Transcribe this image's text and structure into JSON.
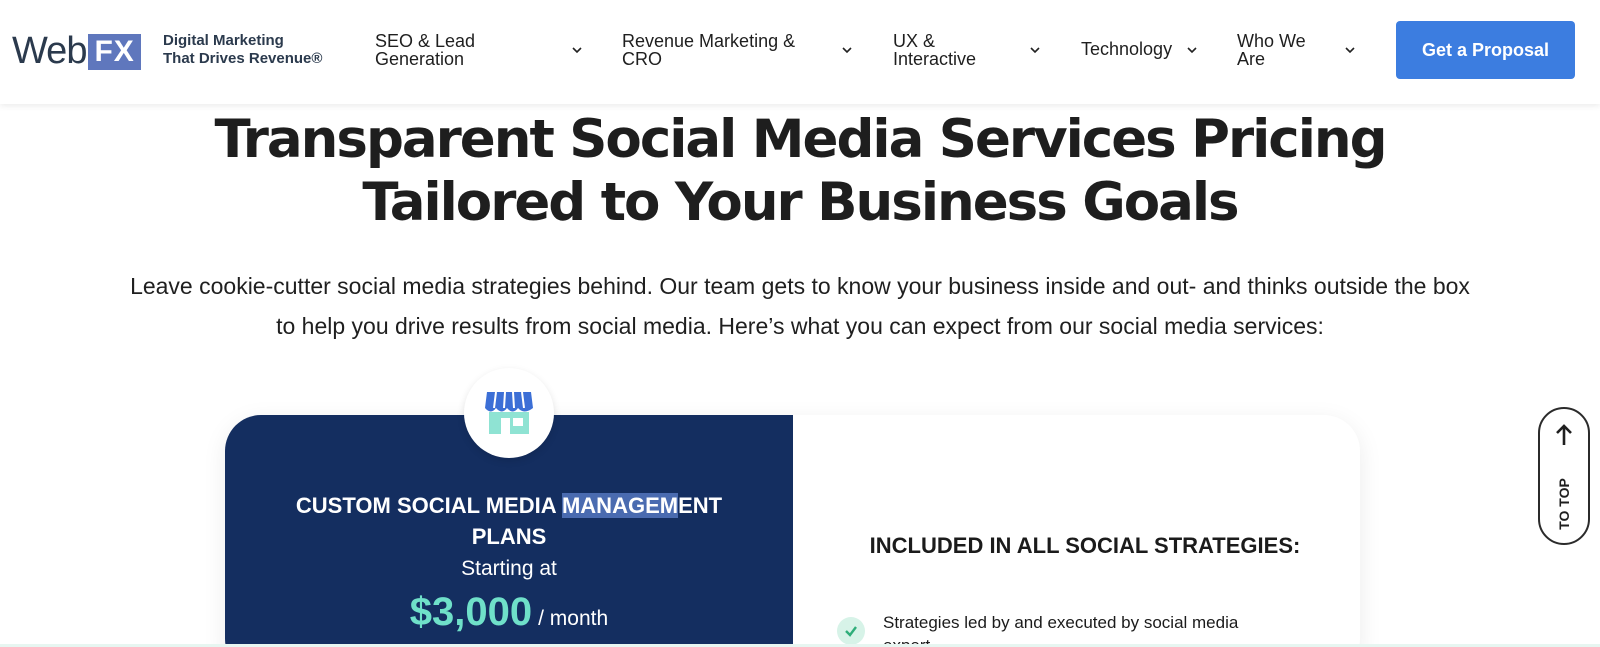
{
  "brand": {
    "logo_text_web": "Web",
    "logo_text_fx": "FX",
    "tagline_line1": "Digital Marketing",
    "tagline_line2": "That Drives Revenue®"
  },
  "nav": {
    "items": [
      {
        "label_line1": "SEO & Lead",
        "label_line2": "Generation"
      },
      {
        "label_line1": "Revenue Marketing &",
        "label_line2": "CRO"
      },
      {
        "label_line1": "UX &",
        "label_line2": "Interactive"
      },
      {
        "label_line1": "Technology",
        "label_line2": ""
      },
      {
        "label_line1": "Who We",
        "label_line2": "Are"
      }
    ],
    "cta_label": "Get a Proposal"
  },
  "hero": {
    "title_line1": "Transparent Social Media Services Pricing",
    "title_line2": "Tailored to Your Business Goals",
    "lead_line1": "Leave cookie-cutter social media strategies behind. Our team gets to know your business inside and out- and thinks outside the box",
    "lead_line2": "to help you drive results from social media. Here’s what you can expect from our social media services:"
  },
  "pricing": {
    "plan_name_line1_a": "CUSTOM SOCIAL MEDIA ",
    "plan_name_line1_highlight": "MANAGEM",
    "plan_name_line1_b": "ENT",
    "plan_name_line2": "PLANS",
    "starting_label": "Starting at",
    "price": "$3,000",
    "period": "/ month",
    "included_title": "INCLUDED IN ALL SOCIAL STRATEGIES:",
    "features": [
      {
        "text": "Strategies led by and executed by social media expert"
      }
    ]
  },
  "to_top": {
    "label": "TO TOP"
  },
  "colors": {
    "brand_blue": "#5f77bd",
    "cta_blue": "#3c7de0",
    "card_navy": "#142e60",
    "price_teal": "#6fe0c9"
  },
  "icons": {
    "nav_chevron": "chevron-down-icon",
    "plan_icon": "storefront-icon",
    "check": "check-icon",
    "to_top_arrow": "arrow-up-icon"
  }
}
